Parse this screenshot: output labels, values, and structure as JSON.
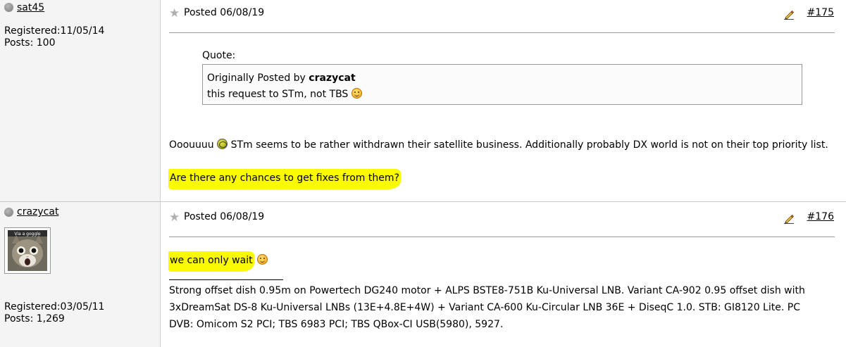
{
  "posts": [
    {
      "username": "sat45",
      "registered": "Registered:11/05/14",
      "posts_count": "Posts: 100",
      "posted": "Posted 06/08/19",
      "post_number": "#175",
      "quote_label": "Quote:",
      "quote_prefix": "Originally Posted by ",
      "quote_author": "crazycat",
      "quote_text": "this request to STm, not TBS",
      "body_lead": "Ooouuuu",
      "body_main": "STm seems to be rather withdrawn their satellite business. Additionally probably DX world is not on their top priority list.",
      "body_highlight": "Are there any chances to get fixes from them?"
    },
    {
      "username": "crazycat",
      "avatar_caption": "Via a goggle",
      "registered": "Registered:03/05/11",
      "posts_count": "Posts: 1,269",
      "posted": "Posted 06/08/19",
      "post_number": "#176",
      "body_highlight": "we can only wait",
      "signature_line1": "Strong offset dish 0.95m on Powertech DG240 motor + ALPS BSTE8-751B Ku-Universal LNB. Variant CA-902 0.95 offset dish with",
      "signature_line2": "3xDreamSat DS-8 Ku-Universal LNBs (13E+4.8E+4W) + Variant CA-600 Ku-Circular LNB 36E + DiseqC 1.0. STB: GI8120 Lite. PC",
      "signature_line3": "DVB: Omicom S2 PCI; TBS 6983 PCI; TBS QBox-CI USB(5980), 5927."
    }
  ],
  "colors": {
    "highlight": "#fbfb00",
    "sidebar_bg": "#f4f4f4",
    "status_offline": "#8a8a8a"
  },
  "icons": {
    "status": "offline-status-icon",
    "post": "star-icon",
    "edit": "edit-pencil-icon",
    "emoticon": "smile-icon",
    "emoticon_dizzy": "dizzy-icon"
  }
}
